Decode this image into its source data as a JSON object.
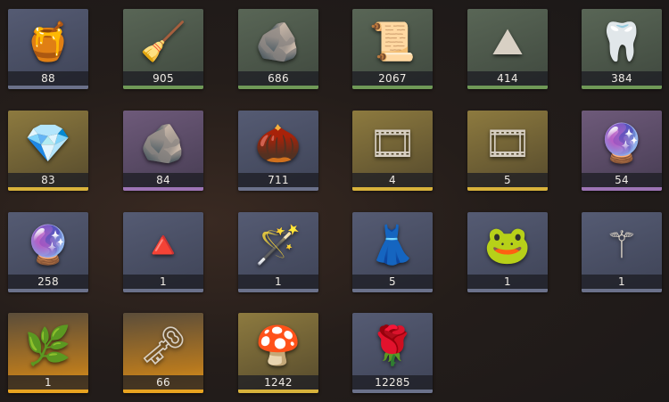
{
  "tier_colors": {
    "slate": "#6b718a",
    "green": "#6f9957",
    "gold": "#d8b23b",
    "purple": "#9d74b5",
    "orange": "#e8a320"
  },
  "items": [
    {
      "icon": "honey-jar-icon",
      "glyph": "🍯",
      "quantity": "88",
      "tier": "slate"
    },
    {
      "icon": "broom-icon",
      "glyph": "🧹",
      "quantity": "905",
      "tier": "green"
    },
    {
      "icon": "silver-ore-icon",
      "glyph": "🪨",
      "quantity": "686",
      "tier": "green"
    },
    {
      "icon": "map-scroll-icon",
      "glyph": "📜",
      "quantity": "2067",
      "tier": "green"
    },
    {
      "icon": "salt-pile-icon",
      "glyph": "⛰",
      "quantity": "414",
      "tier": "green"
    },
    {
      "icon": "tooth-locket-icon",
      "glyph": "🦷",
      "quantity": "384",
      "tier": "green"
    },
    {
      "icon": "crystal-cluster-icon",
      "glyph": "💎",
      "quantity": "83",
      "tier": "gold"
    },
    {
      "icon": "amber-ore-icon",
      "glyph": "🪨",
      "quantity": "84",
      "tier": "purple"
    },
    {
      "icon": "seed-shell-icon",
      "glyph": "🌰",
      "quantity": "711",
      "tier": "slate"
    },
    {
      "icon": "portrait-card-icon",
      "glyph": "🎞",
      "quantity": "4",
      "tier": "gold"
    },
    {
      "icon": "portrait-card-icon",
      "glyph": "🎞",
      "quantity": "5",
      "tier": "gold"
    },
    {
      "icon": "heart-orb-icon",
      "glyph": "🔮",
      "quantity": "54",
      "tier": "purple"
    },
    {
      "icon": "glass-orb-icon",
      "glyph": "🔮",
      "quantity": "258",
      "tier": "slate"
    },
    {
      "icon": "totem-ornament-icon",
      "glyph": "🔺",
      "quantity": "1",
      "tier": "slate"
    },
    {
      "icon": "magic-wand-icon",
      "glyph": "🪄",
      "quantity": "1",
      "tier": "slate"
    },
    {
      "icon": "dress-icon",
      "glyph": "👗",
      "quantity": "5",
      "tier": "slate"
    },
    {
      "icon": "frog-prince-icon",
      "glyph": "🐸",
      "quantity": "1",
      "tier": "slate"
    },
    {
      "icon": "golden-scepter-icon",
      "glyph": "⚚",
      "quantity": "1",
      "tier": "slate"
    },
    {
      "icon": "vine-wreath-icon",
      "glyph": "🌿",
      "quantity": "1",
      "tier": "orange"
    },
    {
      "icon": "silver-key-icon",
      "glyph": "🗝",
      "quantity": "66",
      "tier": "orange"
    },
    {
      "icon": "fungus-cluster-icon",
      "glyph": "🍄",
      "quantity": "1242",
      "tier": "gold"
    },
    {
      "icon": "rose-spiral-icon",
      "glyph": "🌹",
      "quantity": "12285",
      "tier": "slate"
    }
  ]
}
